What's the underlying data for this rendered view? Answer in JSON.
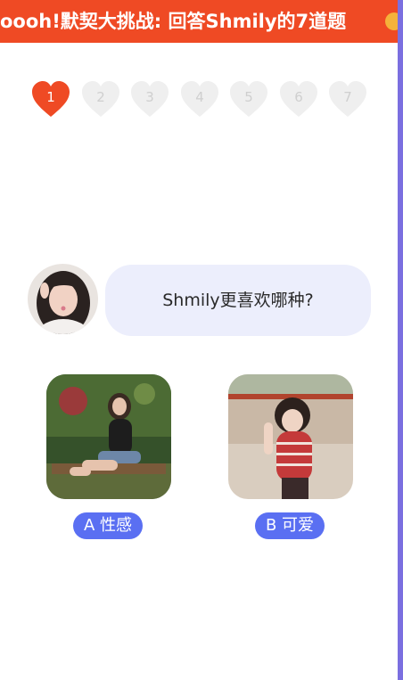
{
  "banner": {
    "title": "oooh!默契大挑战: 回答Shmily的7道题"
  },
  "progress": {
    "current": 1,
    "steps": [
      "1",
      "2",
      "3",
      "4",
      "5",
      "6",
      "7"
    ]
  },
  "question": {
    "text": "Shmily更喜欢哪种?"
  },
  "options": [
    {
      "label": "A 性感"
    },
    {
      "label": "B 可爱"
    }
  ],
  "colors": {
    "banner": "#ef4a24",
    "active_heart": "#ef4a24",
    "inactive_heart": "#efefef",
    "bubble": "#eceefc",
    "option_label": "#5a6ff2",
    "right_rail": "#7b6fe0"
  },
  "icons": [
    "heart-icon",
    "emoji-icon"
  ]
}
